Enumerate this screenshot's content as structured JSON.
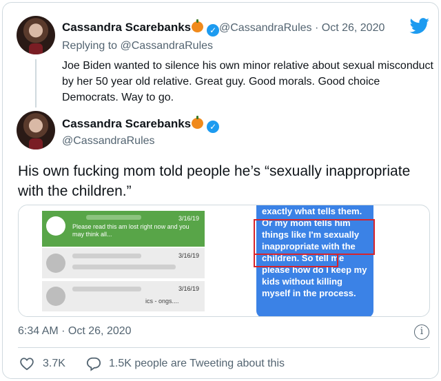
{
  "reply_tweet": {
    "display_name": "Cassandra Scarebanks",
    "handle": "@CassandraRules",
    "date": "· Oct 26, 2020",
    "replying_to": "Replying to @CassandraRules",
    "text": "Joe Biden wanted to silence his own minor relative about sexual misconduct by her 50 year old relative. Great guy. Good morals. Good choice Democrats. Way to go."
  },
  "main_tweet": {
    "display_name": "Cassandra Scarebanks",
    "handle": "@CassandraRules",
    "text": "His own fucking mom told people he’s “sexually inappropriate with the children.”",
    "timestamp": "6:34 AM · Oct 26, 2020",
    "likes": "3.7K",
    "tweeting": "1.5K people are Tweeting about this"
  },
  "media": {
    "left_messages": [
      {
        "date": "3/16/19",
        "text": "Please read this am lost right now and you may think all..."
      },
      {
        "date": "3/16/19",
        "text": ""
      },
      {
        "date": "3/16/19",
        "text": "ics - ongs...."
      }
    ],
    "bubble_text": "exactly what tells them. Or my mom tells him things like I'm sexually inappropriate with the children. So tell me please how do I keep my kids without killing myself in the process."
  },
  "icons": [
    "verified-badge-icon",
    "pumpkin-emoji-icon",
    "twitter-bird-icon",
    "info-icon",
    "heart-icon",
    "reply-bubble-icon"
  ],
  "colors": {
    "verified": "#1d9bf0",
    "muted": "#536471",
    "highlight": "#d8232a"
  }
}
